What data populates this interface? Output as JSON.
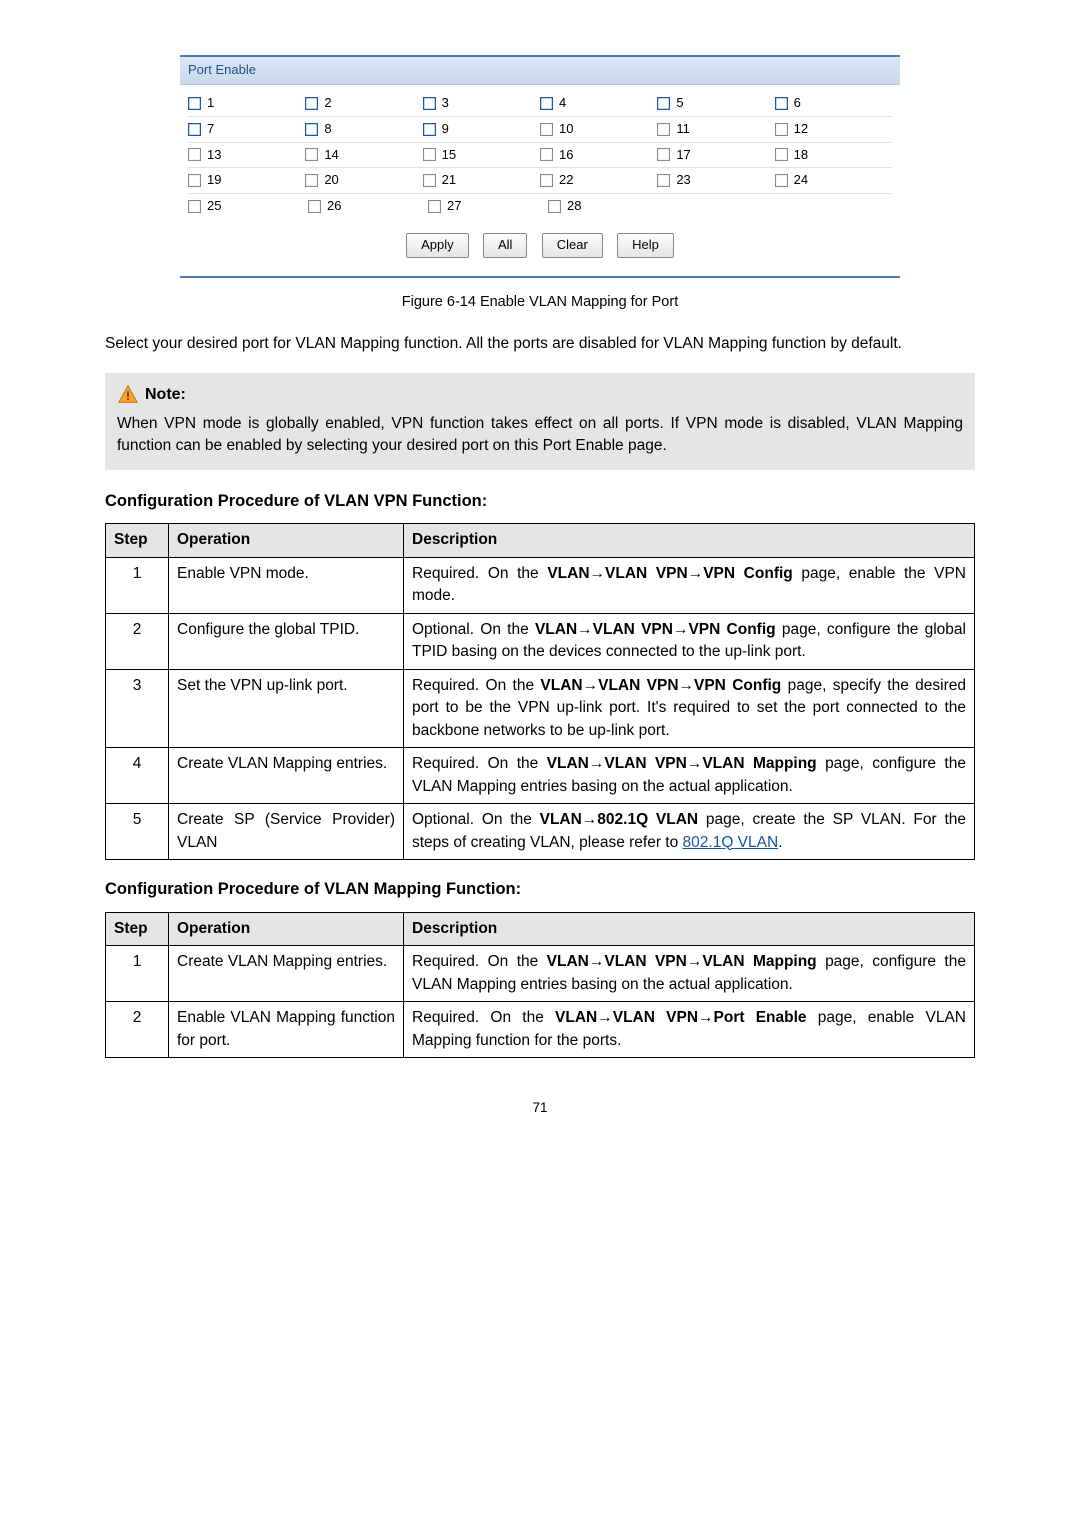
{
  "panel": {
    "header": "Port Enable",
    "ports": {
      "blue": [
        1,
        2,
        3,
        4,
        5,
        6,
        7,
        8,
        9
      ],
      "plain": [
        10,
        11,
        12,
        13,
        14,
        15,
        16,
        17,
        18,
        19,
        20,
        21,
        22,
        23,
        24,
        25,
        26,
        27,
        28
      ]
    },
    "buttons": {
      "apply": "Apply",
      "all": "All",
      "clear": "Clear",
      "help": "Help"
    }
  },
  "figure_caption": "Figure 6-14 Enable VLAN Mapping for Port",
  "intro_text": "Select your desired port for VLAN Mapping function. All the ports are disabled for VLAN Mapping function by default.",
  "note": {
    "label": "Note:",
    "text": "When VPN mode is globally enabled, VPN function takes effect on all ports. If VPN mode is disabled, VLAN Mapping function can be enabled by selecting your desired port on this Port Enable page."
  },
  "section1_title": "Configuration Procedure of VLAN VPN Function:",
  "table_headers": {
    "step": "Step",
    "operation": "Operation",
    "description": "Description"
  },
  "t1": [
    {
      "s": "1",
      "op": "Enable VPN mode.",
      "d_pre": "Required. On the ",
      "d_bold": "VLAN→VLAN VPN→VPN Config",
      "d_post": " page, enable the VPN mode."
    },
    {
      "s": "2",
      "op": "Configure the global TPID.",
      "d_pre": "Optional. On the ",
      "d_bold": "VLAN→VLAN VPN→VPN Config",
      "d_post": " page, configure the global TPID basing on the devices connected to the up-link port."
    },
    {
      "s": "3",
      "op": "Set the VPN up-link port.",
      "d_pre": "Required. On the ",
      "d_bold": "VLAN→VLAN VPN→VPN Config",
      "d_post": " page, specify the desired port to be the VPN up-link port. It's required to set the port connected to the backbone networks to be up-link port."
    },
    {
      "s": "4",
      "op": "Create VLAN Mapping entries.",
      "d_pre": "Required. On the ",
      "d_bold": "VLAN→VLAN VPN→VLAN Mapping",
      "d_post": " page, configure the VLAN Mapping entries basing on the actual application."
    },
    {
      "s": "5",
      "op": "Create SP (Service Provider) VLAN",
      "d_pre": "Optional. On the ",
      "d_bold": "VLAN→802.1Q VLAN",
      "d_post": " page, create the SP VLAN. For the steps of creating VLAN, please refer to ",
      "d_link": "802.1Q VLAN",
      "d_end": "."
    }
  ],
  "section2_title": "Configuration Procedure of VLAN Mapping Function:",
  "t2": [
    {
      "s": "1",
      "op": "Create VLAN Mapping entries.",
      "d_pre": "Required. On the ",
      "d_bold": "VLAN→VLAN VPN→VLAN Mapping",
      "d_post": " page, configure the VLAN Mapping entries basing on the actual application."
    },
    {
      "s": "2",
      "op": "Enable VLAN Mapping function for port.",
      "d_pre": "Required. On the ",
      "d_bold": "VLAN→VLAN VPN→Port Enable",
      "d_post": " page, enable VLAN Mapping function for the ports."
    }
  ],
  "page_number": "71"
}
